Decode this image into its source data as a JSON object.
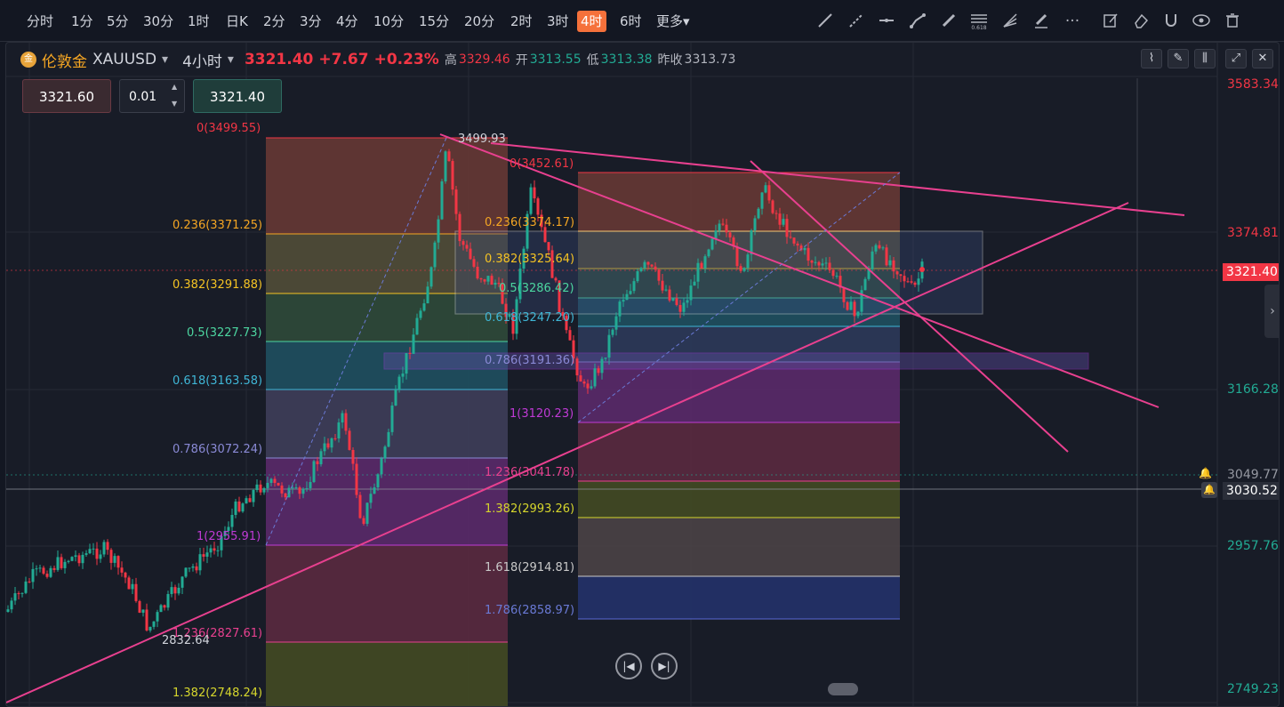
{
  "toolbar": {
    "timeframes": [
      "分时",
      "1分",
      "5分",
      "30分",
      "1时",
      "日K",
      "2分",
      "3分",
      "4分",
      "10分",
      "15分",
      "20分",
      "2时",
      "3时",
      "4时",
      "6时",
      "更多▾"
    ],
    "active_timeframe": "4时",
    "drawing_tools": [
      "trend-line-icon",
      "ray-icon",
      "horizontal-line-icon",
      "path-icon",
      "brush-icon",
      "fib-retracement-icon",
      "fib-fan-icon",
      "highlighter-icon",
      "more-icon",
      "edit-icon",
      "eraser-icon",
      "magnet-icon",
      "eye-icon",
      "trash-icon"
    ],
    "fib_tool_label": "0.618"
  },
  "header": {
    "logo_text": "金",
    "symbol_cn": "伦敦金",
    "symbol": "XAUUSD",
    "interval": "4小时",
    "last_price": "3321.40",
    "change": "+7.67",
    "change_pct": "+0.23%",
    "high_label": "高",
    "high": "3329.46",
    "open_label": "开",
    "open": "3313.55",
    "low_label": "低",
    "low": "3313.38",
    "prev_close_label": "昨收",
    "prev_close": "3313.73"
  },
  "order_panel": {
    "sell_price": "3321.60",
    "quantity": "0.01",
    "buy_price": "3321.40"
  },
  "price_axis": {
    "labels": [
      "3583.34",
      "3374.81",
      "3166.28",
      "2957.76",
      "2749.23"
    ],
    "current_price_tag": "3321.40",
    "alert_price_1": "3049.77",
    "alert_price_2": "3030.52"
  },
  "fib_left": {
    "levels": [
      "0(3499.55)",
      "0.236(3371.25)",
      "0.382(3291.88)",
      "0.5(3227.73)",
      "0.618(3163.58)",
      "0.786(3072.24)",
      "1(2955.91)",
      "1.236(2827.61)",
      "1.382(2748.24)"
    ]
  },
  "fib_right": {
    "levels": [
      "0(3452.61)",
      "0.236(3374.17)",
      "0.382(3325.64)",
      "0.5(3286.42)",
      "0.618(3247.20)",
      "0.786(3191.36)",
      "1(3120.23)",
      "1.236(3041.78)",
      "1.382(2993.26)",
      "1.618(2914.81)",
      "1.786(2858.97)"
    ]
  },
  "annotations": {
    "high_marker": "3499.93",
    "low_marker": "2832.64"
  },
  "colors": {
    "up": "#22ab94",
    "down": "#f23645",
    "trendline": "#e8408f",
    "accent": "#f5713b"
  }
}
